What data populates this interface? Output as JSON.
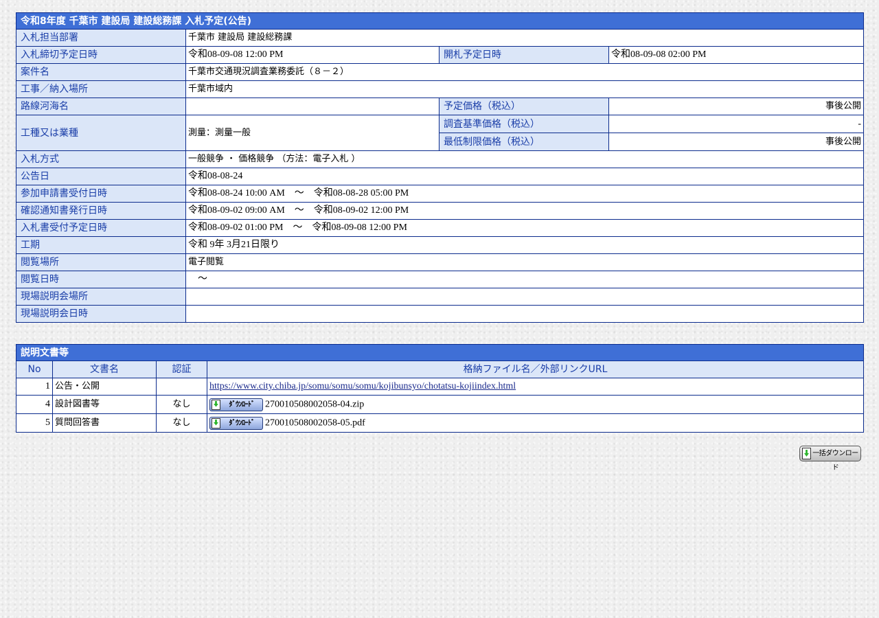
{
  "notice": {
    "title": "令和8年度 千葉市 建設局 建設総務課 入札予定(公告)",
    "dept_label": "入札担当部署",
    "dept_value": "千葉市 建設局 建設総務課",
    "deadline_label": "入札締切予定日時",
    "deadline_value": "令和08-09-08 12:00 PM",
    "opening_label": "開札予定日時",
    "opening_value": "令和08-09-08 02:00 PM",
    "case_label": "案件名",
    "case_value": "千葉市交通現況調査業務委託（８－２）",
    "place_label": "工事／納入場所",
    "place_value": "千葉市域内",
    "route_label": "路線河海名",
    "route_value": "",
    "planned_price_label": "予定価格（税込）",
    "planned_price_value": "事後公開",
    "work_type_label": "工種又は業種",
    "work_type_value": "測量：測量一般",
    "survey_price_label": "調査基準価格（税込）",
    "survey_price_value": "-",
    "min_price_label": "最低制限価格（税込）",
    "min_price_value": "事後公開",
    "method_label": "入札方式",
    "method_value": "一般競争 ・ 価格競争 （方法：電子入札 ）",
    "announce_label": "公告日",
    "announce_value": "令和08-08-24",
    "application_label": "参加申請書受付日時",
    "application_value": "令和08-08-24 10:00 AM　～　令和08-08-28 05:00 PM",
    "confirm_label": "確認通知書発行日時",
    "confirm_value": "令和08-09-02 09:00 AM　～　令和08-09-02 12:00 PM",
    "bid_accept_label": "入札書受付予定日時",
    "bid_accept_value": "令和08-09-02 01:00 PM　～　令和08-09-08 12:00 PM",
    "period_label": "工期",
    "period_value": "令和 9年 3月21日限り",
    "viewing_place_label": "閲覧場所",
    "viewing_place_value": "電子閲覧",
    "viewing_time_label": "閲覧日時",
    "viewing_time_value": "　～",
    "site_place_label": "現場説明会場所",
    "site_place_value": "",
    "site_time_label": "現場説明会日時",
    "site_time_value": ""
  },
  "docs": {
    "title": "説明文書等",
    "headers": {
      "no": "No",
      "name": "文書名",
      "auth": "認証",
      "file": "格納ファイル名／外部リンクURL"
    },
    "rows": [
      {
        "no": "1",
        "name": "公告・公開",
        "auth": "",
        "link": "https://www.city.chiba.jp/somu/somu/somu/kojibunsyo/chotatsu-kojiindex.html"
      },
      {
        "no": "4",
        "name": "設計図書等",
        "auth": "なし",
        "button": "ﾀﾞｳﾝﾛｰﾄﾞ",
        "file": "270010508002058-04.zip"
      },
      {
        "no": "5",
        "name": "質問回答書",
        "auth": "なし",
        "button": "ﾀﾞｳﾝﾛｰﾄﾞ",
        "file": "270010508002058-05.pdf"
      }
    ]
  },
  "bulk_download": {
    "label": "一括ダウンロード"
  },
  "colors": {
    "header_bg": "#3f6fd6",
    "label_bg": "#dbe6f8",
    "label_text": "#1a3ea8",
    "border": "#0a2a8c"
  }
}
